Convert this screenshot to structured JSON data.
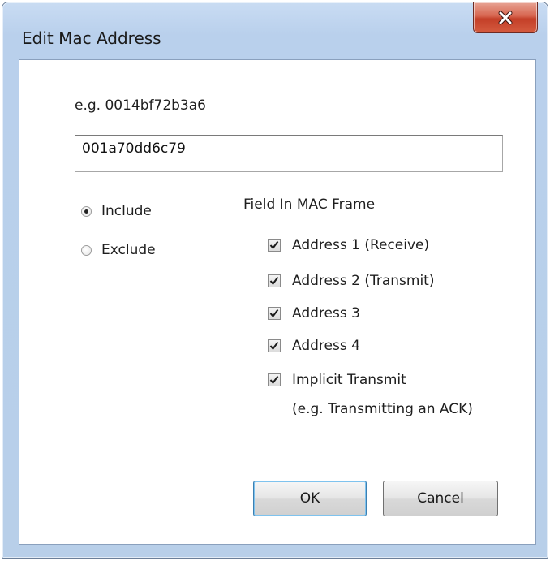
{
  "window": {
    "title": "Edit Mac Address"
  },
  "form": {
    "example": "e.g.  0014bf72b3a6",
    "mac_value": "001a70dd6c79"
  },
  "mode": {
    "include_label": "Include",
    "exclude_label": "Exclude",
    "selected": "Include"
  },
  "fields": {
    "group_title": "Field In MAC Frame",
    "address1": "Address 1 (Receive)",
    "address2": "Address 2 (Transmit)",
    "address3": "Address 3",
    "address4": "Address 4",
    "implicit": "Implicit Transmit",
    "implicit_note": "(e.g. Transmitting an ACK)"
  },
  "buttons": {
    "ok": "OK",
    "cancel": "Cancel"
  },
  "icons": {
    "close": "close-icon",
    "check": "checkmark-icon"
  },
  "colors": {
    "frame": "#b9d0ec",
    "close_button": "#c43f28"
  }
}
